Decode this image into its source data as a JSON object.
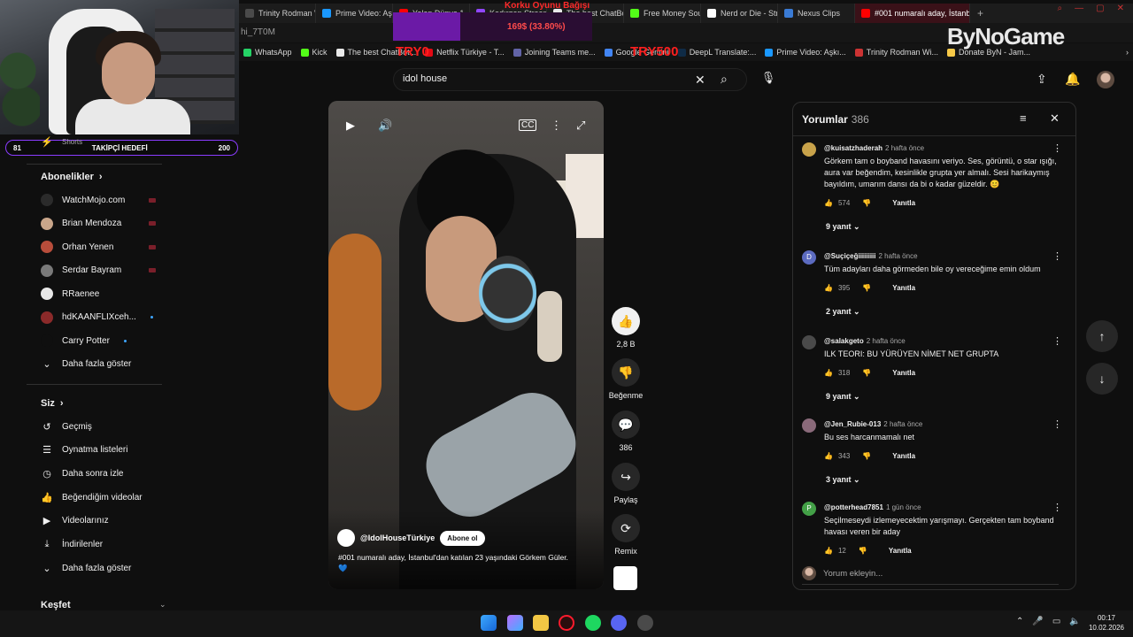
{
  "browser": {
    "tabs": [
      {
        "label": "Trinity Rodman Wi",
        "color": "#4a4a4a"
      },
      {
        "label": "Prime Video: Aşkı",
        "color": "#1a98ff"
      },
      {
        "label": "Yalan Dünya 1. B",
        "color": "#ff0000"
      },
      {
        "label": "Kadırgap Stream",
        "color": "#9146ff"
      },
      {
        "label": "The best ChatBot",
        "color": "#e8e8e8"
      },
      {
        "label": "Free Money Soun",
        "color": "#53fc18"
      },
      {
        "label": "Nerd or Die - Stre",
        "color": "#ffffff"
      },
      {
        "label": "Nexus Clips",
        "color": "#3a7bd5"
      },
      {
        "label": "#001 numaralı aday, İstanb",
        "color": "#ff0000"
      }
    ],
    "url": "hi_7T0M",
    "bookmarks": [
      {
        "label": "WhatsApp",
        "color": "#25d366"
      },
      {
        "label": "Kick",
        "color": "#53fc18"
      },
      {
        "label": "The best ChatBot...",
        "color": "#e8e8e8"
      },
      {
        "label": "Netflix Türkiye - T...",
        "color": "#e50914"
      },
      {
        "label": "Joining Teams me...",
        "color": "#6264a7"
      },
      {
        "label": "Google Gemini",
        "color": "#4285f4"
      },
      {
        "label": "DeepL Translate:...",
        "color": "#0f2b46"
      },
      {
        "label": "Prime Video: Aşkı...",
        "color": "#1a98ff"
      },
      {
        "label": "Trinity Rodman Wi...",
        "color": "#c33"
      },
      {
        "label": "Donate ByN - Jam...",
        "color": "#f7c948"
      }
    ]
  },
  "stream_overlay": {
    "title": "Korku Oyunu Bağışı",
    "progress": "169$ (33.80%)",
    "progress_fraction": 0.338,
    "try_left": "TRY0",
    "try_right": "TRY500",
    "brand": "ByNoGame",
    "goal_label": "TAKİPÇİ HEDEFİ",
    "goal_current": "81",
    "goal_target": "200"
  },
  "sidebar": {
    "shorts_label": "Shorts",
    "subs_title": "Abonelikler",
    "subscriptions": [
      {
        "name": "WatchMojo.com",
        "color": "#2b2b2b",
        "badge": "live"
      },
      {
        "name": "Brian Mendoza",
        "color": "#c9a68a",
        "badge": "live"
      },
      {
        "name": "Orhan Yenen",
        "color": "#b84d3b",
        "badge": "live"
      },
      {
        "name": "Serdar Bayram",
        "color": "#7a7a7a",
        "badge": "live"
      },
      {
        "name": "RRaenee",
        "color": "#e8e8e8",
        "badge": "none"
      },
      {
        "name": "hdKAANFLIXceh...",
        "color": "#8b2a2a",
        "badge": "dot"
      },
      {
        "name": "Carry Potter",
        "color": "#0f0f0f",
        "badge": "dot"
      }
    ],
    "subs_more": "Daha fazla göster",
    "you_title": "Siz",
    "you_items": [
      {
        "label": "Geçmiş",
        "icon": "history-icon"
      },
      {
        "label": "Oynatma listeleri",
        "icon": "playlist-icon"
      },
      {
        "label": "Daha sonra izle",
        "icon": "watch-later-icon"
      },
      {
        "label": "Beğendiğim videolar",
        "icon": "like-icon"
      },
      {
        "label": "Videolarınız",
        "icon": "video-icon"
      },
      {
        "label": "İndirilenler",
        "icon": "download-icon"
      }
    ],
    "you_more": "Daha fazla göster",
    "explore_title": "Keşfet"
  },
  "search": {
    "value": "idol house"
  },
  "video": {
    "channel": "@IdolHouseTürkiye",
    "subscribe_label": "Abone ol",
    "caption": "#001 numaralı aday, İstanbul'dan katılan 23 yaşındaki Görkem Güler.",
    "caption_emoji": "💙"
  },
  "actions": {
    "likes": "2,8 B",
    "dislike_label": "Beğenme",
    "comments": "386",
    "share_label": "Paylaş",
    "remix_label": "Remix"
  },
  "comments": {
    "title": "Yorumlar",
    "count": "386",
    "items": [
      {
        "author": "@kuisatzhaderah",
        "time": "2 hafta önce",
        "text": "Görkem tam o boyband havasını veriyo. Ses, görüntü, o star ışığı, aura var beğendim, kesinlikle grupta yer almalı. Sesi harikaymış bayıldım, umarım dansı da bi o kadar güzeldir. 😊",
        "likes": "574",
        "replies": "9 yanıt",
        "avatar_color": "#c8a24a",
        "initial": ""
      },
      {
        "author": "@Suçiçeğiiiiiiiii",
        "time": "2 hafta önce",
        "text": "Tüm adayları daha görmeden bile oy vereceğime emin oldum",
        "likes": "395",
        "replies": "2 yanıt",
        "avatar_color": "#5c6bc0",
        "initial": "D"
      },
      {
        "author": "@salakgeto",
        "time": "2 hafta önce",
        "text": "ILK TEORI: BU YÜRÜYEN NİMET NET GRUPTA",
        "likes": "318",
        "replies": "9 yanıt",
        "avatar_color": "#4a4a4a",
        "initial": ""
      },
      {
        "author": "@Jen_Rubie-013",
        "time": "2 hafta önce",
        "text": "Bu ses harcanmamalı net",
        "likes": "343",
        "replies": "3 yanıt",
        "avatar_color": "#8a6a7a",
        "initial": ""
      },
      {
        "author": "@potterhead7851",
        "time": "1 gün önce",
        "text": "Seçilmeseydi izlemeyecektim yarışmayı. Gerçekten tam boyband havası veren bir aday",
        "likes": "12",
        "replies": "",
        "avatar_color": "#43a047",
        "initial": "P"
      }
    ],
    "reply_label": "Yanıtla",
    "add_placeholder": "Yorum ekleyin..."
  },
  "taskbar": {
    "time": "00:17",
    "date": "10.02.2026"
  }
}
